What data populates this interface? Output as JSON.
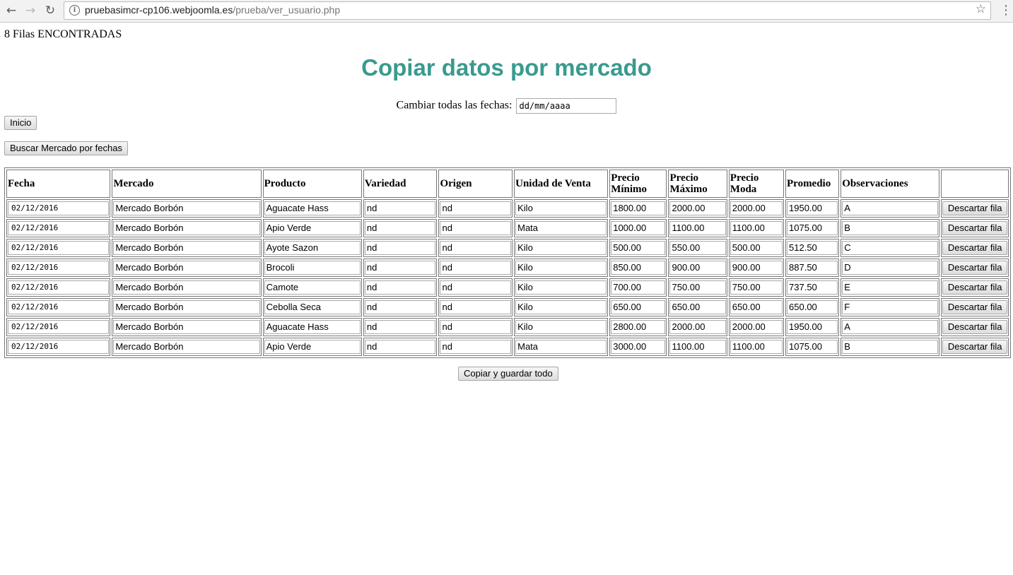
{
  "browser": {
    "url_host": "pruebasimcr-cp106.webjoomla.es",
    "url_path": "/prueba/ver_usuario.php"
  },
  "page": {
    "count_text": "8 Filas ENCONTRADAS",
    "title": "Copiar datos por mercado",
    "change_dates_label": "Cambiar todas las fechas:",
    "date_placeholder": "dd/mm/aaaa",
    "inicio_button": "Inicio",
    "buscar_button": "Buscar Mercado por fechas",
    "guardar_button": "Copiar y guardar todo",
    "title_color": "#3a9a8e"
  },
  "table": {
    "headers": [
      "Fecha",
      "Mercado",
      "Producto",
      "Variedad",
      "Origen",
      "Unidad de Venta",
      "Precio Mínimo",
      "Precio Máximo",
      "Precio Moda",
      "Promedio",
      "Observaciones",
      ""
    ],
    "discard_label": "Descartar fila",
    "rows": [
      [
        "02/12/2016",
        "Mercado Borbón",
        "Aguacate Hass",
        "nd",
        "nd",
        "Kilo",
        "1800.00",
        "2000.00",
        "2000.00",
        "1950.00",
        "A"
      ],
      [
        "02/12/2016",
        "Mercado Borbón",
        "Apio Verde",
        "nd",
        "nd",
        "Mata",
        "1000.00",
        "1100.00",
        "1100.00",
        "1075.00",
        "B"
      ],
      [
        "02/12/2016",
        "Mercado Borbón",
        "Ayote Sazon",
        "nd",
        "nd",
        "Kilo",
        "500.00",
        "550.00",
        "500.00",
        "512.50",
        "C"
      ],
      [
        "02/12/2016",
        "Mercado Borbón",
        "Brocoli",
        "nd",
        "nd",
        "Kilo",
        "850.00",
        "900.00",
        "900.00",
        "887.50",
        "D"
      ],
      [
        "02/12/2016",
        "Mercado Borbón",
        "Camote",
        "nd",
        "nd",
        "Kilo",
        "700.00",
        "750.00",
        "750.00",
        "737.50",
        "E"
      ],
      [
        "02/12/2016",
        "Mercado Borbón",
        "Cebolla Seca",
        "nd",
        "nd",
        "Kilo",
        "650.00",
        "650.00",
        "650.00",
        "650.00",
        "F"
      ],
      [
        "02/12/2016",
        "Mercado Borbón",
        "Aguacate Hass",
        "nd",
        "nd",
        "Kilo",
        "2800.00",
        "2000.00",
        "2000.00",
        "1950.00",
        "A"
      ],
      [
        "02/12/2016",
        "Mercado Borbón",
        "Apio Verde",
        "nd",
        "nd",
        "Mata",
        "3000.00",
        "1100.00",
        "1100.00",
        "1075.00",
        "B"
      ]
    ]
  }
}
